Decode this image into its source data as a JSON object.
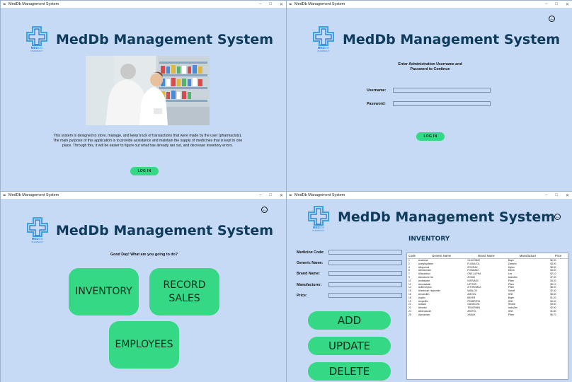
{
  "window_title": "MedDb  Management System",
  "app_title": "MedDb Management System",
  "logo": {
    "line1": "MED",
    "line1_accent": "DB",
    "line2": "PHARMACY"
  },
  "welcome": {
    "description": "This system is designed to store, manage, and keep track of transactions that were made by the user (pharmacists). The main purpose of this application is to provide assistance and maintain the supply of medicines that is kept in one place. Through this, it will be easier to figure out what has already ran out, and decrease inventory errors.",
    "login_label": "LOG IN"
  },
  "login": {
    "prompt_line1": "Enter Administration Username and",
    "prompt_line2": "Password to Continue",
    "username_label": "Username:",
    "password_label": "Password:",
    "username_value": "",
    "password_value": "",
    "login_label": "LOG IN"
  },
  "menu": {
    "greeting": "Good Day! What are you going to do?",
    "inventory_label": "INVENTORY",
    "record_sales_line1": "RECORD",
    "record_sales_line2": "SALES",
    "employees_label": "EMPLOYEES"
  },
  "inventory": {
    "heading": "INVENTORY",
    "fields": {
      "medicine_code": "Medicine Code:",
      "generic_name": "Generic Name:",
      "brand_name": "Brand Name:",
      "manufacturer": "Manufacturer:",
      "price": "Price:"
    },
    "add_label": "ADD",
    "update_label": "UPDATE",
    "delete_label": "DELETE",
    "columns": [
      "Code",
      "Generic Name",
      "Brand Name",
      "Manufactuer",
      "Price"
    ],
    "rows": [
      [
        "1",
        "Acarbose",
        "GLUCOBAY",
        "Bayer",
        "$6.30"
      ],
      [
        "2",
        "Acetylcysteine",
        "FLUIMUCIL",
        "Zambon",
        "$3.00"
      ],
      [
        "4",
        "Allopurinol",
        "ZOVIRAX",
        "Mylan",
        "$6.30"
      ],
      [
        "8",
        "Alendronate",
        "FOSAMAX",
        "Merck",
        "$4.50"
      ],
      [
        "7",
        "Alfacalcidol",
        "ONE-ALPHA",
        "Leo",
        "$2.10"
      ],
      [
        "9",
        "Alendronic Na",
        "ZOMIG",
        "AstraZen",
        "$7.00"
      ],
      [
        "11",
        "Amlodipine",
        "NORVASC",
        "Pfizer",
        "$4.20"
      ],
      [
        "12",
        "Atorvastatin",
        "LIPITOR",
        "Pfizer",
        "$9.10"
      ],
      [
        "14",
        "Azithromycin",
        "ZITHROMAX",
        "Pfizer",
        "$8.00"
      ],
      [
        "15",
        "Aluminium Hydroxide",
        "MAALOX",
        "Sanofi",
        "$2.30"
      ],
      [
        "16",
        "Amoxicillin",
        "AMOXIL",
        "GSK",
        "$5.60"
      ],
      [
        "18",
        "Aspirin",
        "BAYER",
        "Bayer",
        "$1.20"
      ],
      [
        "19",
        "Ampicillin",
        "PENBRITIN",
        "GSK",
        "$4.40"
      ],
      [
        "21",
        "Antacid",
        "GAVISCON",
        "Reckitt",
        "$3.50"
      ],
      [
        "22",
        "Atenolol",
        "TENORMIN",
        "AstraZen",
        "$2.90"
      ],
      [
        "24",
        "Albendazole",
        "ZENTEL",
        "GSK",
        "$1.80"
      ],
      [
        "25",
        "Alprazolam",
        "XANAX",
        "Pfizer",
        "$6.70"
      ]
    ]
  }
}
